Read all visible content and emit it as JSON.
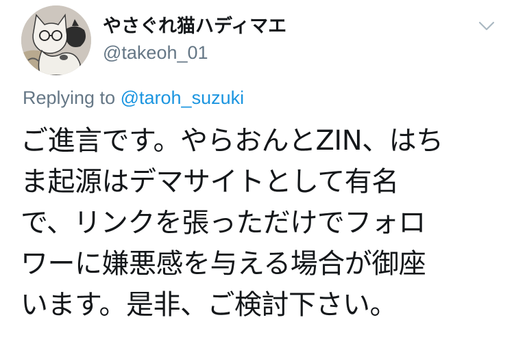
{
  "author": {
    "display_name": "やさぐれ猫ハディマエ",
    "handle": "@takeoh_01",
    "avatar_icon": "cat-avatar-icon"
  },
  "header": {
    "menu_icon": "chevron-down-icon"
  },
  "reply": {
    "prefix": "Replying to",
    "mention": "@taroh_suzuki"
  },
  "tweet": {
    "lines": [
      "ご進言です。やらおんとZIN、はち",
      "ま起源はデマサイトとして有名",
      "で、リンクを張っただけでフォロ",
      "ワーに嫌悪感を与える場合が御座",
      "います。是非、ご検討下さい。"
    ]
  },
  "colors": {
    "text_primary": "#14171a",
    "text_secondary": "#657786",
    "link": "#1b95e0"
  }
}
